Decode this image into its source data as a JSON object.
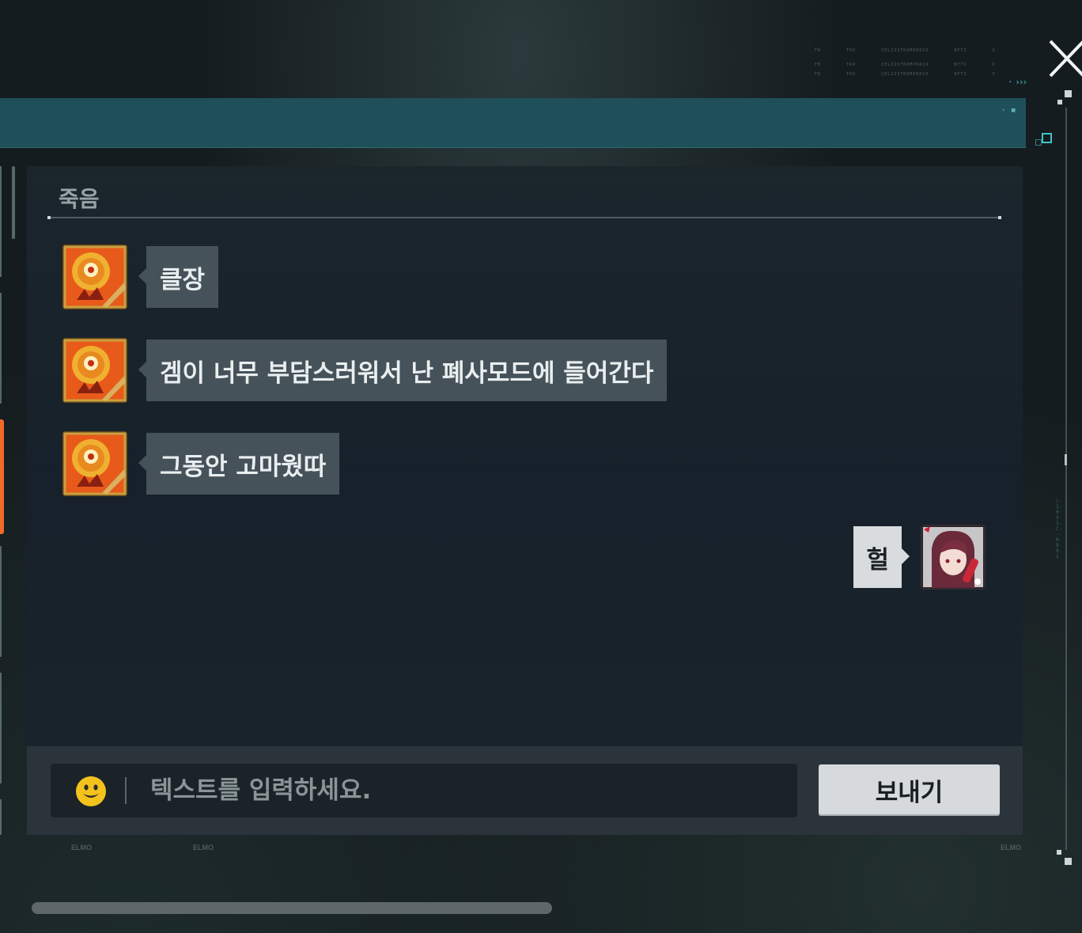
{
  "window": {
    "close_icon": "close-x-icon",
    "header_color": "#1f5059",
    "corner_text": [
      "FB        TRX        CELIXSTKOMPKRIX        NTTI        X",
      "FB        TRX        CELIXSTKOMPKRIX        NTTI        X",
      "FB        TRX        CELIXSTKOMPKRIX        NTTI        X"
    ]
  },
  "chat": {
    "title": "죽음",
    "messages": [
      {
        "sender": "other",
        "avatar_icon": "orange-lion-badge-avatar",
        "text": "클장"
      },
      {
        "sender": "other",
        "avatar_icon": "orange-lion-badge-avatar",
        "text": "겜이 너무 부담스러워서 난 폐사모드에 들어간다"
      },
      {
        "sender": "other",
        "avatar_icon": "orange-lion-badge-avatar",
        "text": "그동안 고마웠따"
      },
      {
        "sender": "self",
        "avatar_icon": "red-haired-girl-avatar",
        "text": "헐"
      }
    ],
    "colors": {
      "other_bubble": "#46525a",
      "self_bubble": "#d8dcde",
      "accent": "#f06a2a"
    }
  },
  "input": {
    "emoji_icon": "smiley-emoji-icon",
    "placeholder": "텍스트를 입력하세요.",
    "value": "",
    "send_label": "보내기"
  },
  "footer": {
    "labels": [
      "ELMO",
      "ELMO",
      "ELMO"
    ]
  }
}
